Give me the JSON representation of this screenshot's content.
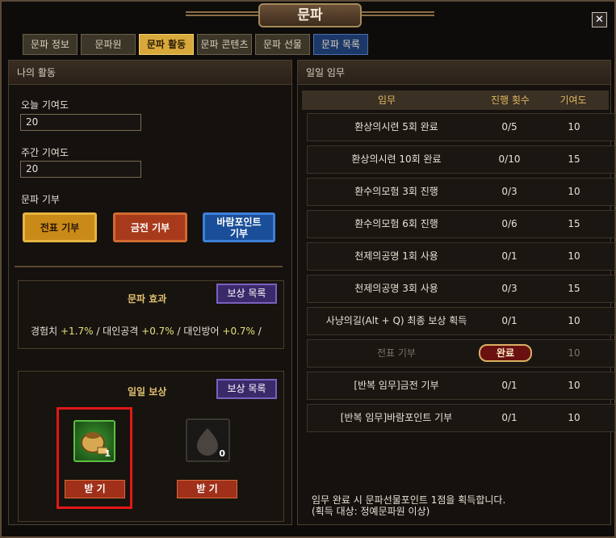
{
  "window": {
    "title": "문파",
    "close_label": "✕"
  },
  "tabs": [
    {
      "label": "문파 정보",
      "active": false
    },
    {
      "label": "문파원",
      "active": false
    },
    {
      "label": "문파 활동",
      "active": true
    },
    {
      "label": "문파 콘텐츠",
      "active": false
    },
    {
      "label": "문파 선물",
      "active": false
    },
    {
      "label": "문파 목록",
      "active": false
    }
  ],
  "left": {
    "header": "나의 활동",
    "today_label": "오늘 기여도",
    "today_value": "20",
    "weekly_label": "주간 기여도",
    "weekly_value": "20",
    "donation_label": "문파 기부",
    "donate_buttons": [
      "전표 기부",
      "금전 기부",
      "바람포인트 기부"
    ],
    "effect": {
      "title": "문파 효과",
      "list_button": "보상 목록",
      "exp_label": "경험치",
      "exp_value": "+1.7%",
      "atk_label": "대인공격",
      "atk_value": "+0.7%",
      "def_label": "대인방어",
      "def_value": "+0.7%"
    },
    "daily": {
      "title": "일일 보상",
      "list_button": "보상 목록",
      "items": [
        {
          "icon": "pouch-icon",
          "count": "1",
          "button": "받 기"
        },
        {
          "icon": "blob-icon",
          "count": "0",
          "button": "받 기"
        }
      ]
    }
  },
  "right": {
    "header": "일일 임무",
    "columns": [
      "임무",
      "진행 횟수",
      "기여도"
    ],
    "rows": [
      {
        "mission": "환상의시련 5회 완료",
        "progress": "0/5",
        "points": "10"
      },
      {
        "mission": "환상의시련 10회 완료",
        "progress": "0/10",
        "points": "15"
      },
      {
        "mission": "환수의모험 3회 진행",
        "progress": "0/3",
        "points": "10"
      },
      {
        "mission": "환수의모험 6회 진행",
        "progress": "0/6",
        "points": "15"
      },
      {
        "mission": "천제의공명 1회 사용",
        "progress": "0/1",
        "points": "10"
      },
      {
        "mission": "천제의공명 3회 사용",
        "progress": "0/3",
        "points": "15"
      },
      {
        "mission": "사냥의길(Alt + Q) 최종 보상 획득",
        "progress": "0/1",
        "points": "10"
      },
      {
        "mission": "전표 기부",
        "progress": "완료",
        "points": "10",
        "done": true
      },
      {
        "mission": "[반복 임무]금전 기부",
        "progress": "0/1",
        "points": "10"
      },
      {
        "mission": "[반복 임무]바람포인트 기부",
        "progress": "0/1",
        "points": "10"
      }
    ],
    "footer_line1": "임무 완료 시 문파선물포인트 1점을 획득합니다.",
    "footer_line2": "(획득 대상: 정예문파원 이상)"
  }
}
